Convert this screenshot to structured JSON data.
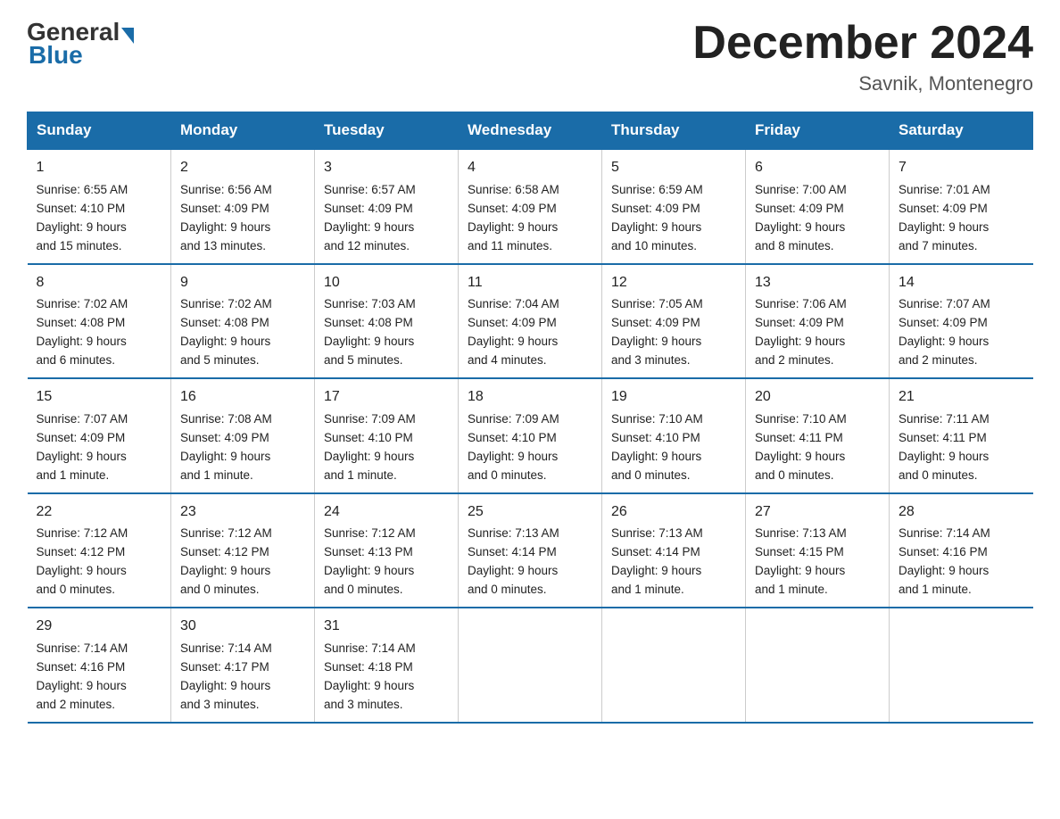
{
  "header": {
    "logo_general": "General",
    "logo_blue": "Blue",
    "main_title": "December 2024",
    "subtitle": "Savnik, Montenegro"
  },
  "weekdays": [
    "Sunday",
    "Monday",
    "Tuesday",
    "Wednesday",
    "Thursday",
    "Friday",
    "Saturday"
  ],
  "weeks": [
    [
      {
        "day": "1",
        "info": "Sunrise: 6:55 AM\nSunset: 4:10 PM\nDaylight: 9 hours\nand 15 minutes."
      },
      {
        "day": "2",
        "info": "Sunrise: 6:56 AM\nSunset: 4:09 PM\nDaylight: 9 hours\nand 13 minutes."
      },
      {
        "day": "3",
        "info": "Sunrise: 6:57 AM\nSunset: 4:09 PM\nDaylight: 9 hours\nand 12 minutes."
      },
      {
        "day": "4",
        "info": "Sunrise: 6:58 AM\nSunset: 4:09 PM\nDaylight: 9 hours\nand 11 minutes."
      },
      {
        "day": "5",
        "info": "Sunrise: 6:59 AM\nSunset: 4:09 PM\nDaylight: 9 hours\nand 10 minutes."
      },
      {
        "day": "6",
        "info": "Sunrise: 7:00 AM\nSunset: 4:09 PM\nDaylight: 9 hours\nand 8 minutes."
      },
      {
        "day": "7",
        "info": "Sunrise: 7:01 AM\nSunset: 4:09 PM\nDaylight: 9 hours\nand 7 minutes."
      }
    ],
    [
      {
        "day": "8",
        "info": "Sunrise: 7:02 AM\nSunset: 4:08 PM\nDaylight: 9 hours\nand 6 minutes."
      },
      {
        "day": "9",
        "info": "Sunrise: 7:02 AM\nSunset: 4:08 PM\nDaylight: 9 hours\nand 5 minutes."
      },
      {
        "day": "10",
        "info": "Sunrise: 7:03 AM\nSunset: 4:08 PM\nDaylight: 9 hours\nand 5 minutes."
      },
      {
        "day": "11",
        "info": "Sunrise: 7:04 AM\nSunset: 4:09 PM\nDaylight: 9 hours\nand 4 minutes."
      },
      {
        "day": "12",
        "info": "Sunrise: 7:05 AM\nSunset: 4:09 PM\nDaylight: 9 hours\nand 3 minutes."
      },
      {
        "day": "13",
        "info": "Sunrise: 7:06 AM\nSunset: 4:09 PM\nDaylight: 9 hours\nand 2 minutes."
      },
      {
        "day": "14",
        "info": "Sunrise: 7:07 AM\nSunset: 4:09 PM\nDaylight: 9 hours\nand 2 minutes."
      }
    ],
    [
      {
        "day": "15",
        "info": "Sunrise: 7:07 AM\nSunset: 4:09 PM\nDaylight: 9 hours\nand 1 minute."
      },
      {
        "day": "16",
        "info": "Sunrise: 7:08 AM\nSunset: 4:09 PM\nDaylight: 9 hours\nand 1 minute."
      },
      {
        "day": "17",
        "info": "Sunrise: 7:09 AM\nSunset: 4:10 PM\nDaylight: 9 hours\nand 1 minute."
      },
      {
        "day": "18",
        "info": "Sunrise: 7:09 AM\nSunset: 4:10 PM\nDaylight: 9 hours\nand 0 minutes."
      },
      {
        "day": "19",
        "info": "Sunrise: 7:10 AM\nSunset: 4:10 PM\nDaylight: 9 hours\nand 0 minutes."
      },
      {
        "day": "20",
        "info": "Sunrise: 7:10 AM\nSunset: 4:11 PM\nDaylight: 9 hours\nand 0 minutes."
      },
      {
        "day": "21",
        "info": "Sunrise: 7:11 AM\nSunset: 4:11 PM\nDaylight: 9 hours\nand 0 minutes."
      }
    ],
    [
      {
        "day": "22",
        "info": "Sunrise: 7:12 AM\nSunset: 4:12 PM\nDaylight: 9 hours\nand 0 minutes."
      },
      {
        "day": "23",
        "info": "Sunrise: 7:12 AM\nSunset: 4:12 PM\nDaylight: 9 hours\nand 0 minutes."
      },
      {
        "day": "24",
        "info": "Sunrise: 7:12 AM\nSunset: 4:13 PM\nDaylight: 9 hours\nand 0 minutes."
      },
      {
        "day": "25",
        "info": "Sunrise: 7:13 AM\nSunset: 4:14 PM\nDaylight: 9 hours\nand 0 minutes."
      },
      {
        "day": "26",
        "info": "Sunrise: 7:13 AM\nSunset: 4:14 PM\nDaylight: 9 hours\nand 1 minute."
      },
      {
        "day": "27",
        "info": "Sunrise: 7:13 AM\nSunset: 4:15 PM\nDaylight: 9 hours\nand 1 minute."
      },
      {
        "day": "28",
        "info": "Sunrise: 7:14 AM\nSunset: 4:16 PM\nDaylight: 9 hours\nand 1 minute."
      }
    ],
    [
      {
        "day": "29",
        "info": "Sunrise: 7:14 AM\nSunset: 4:16 PM\nDaylight: 9 hours\nand 2 minutes."
      },
      {
        "day": "30",
        "info": "Sunrise: 7:14 AM\nSunset: 4:17 PM\nDaylight: 9 hours\nand 3 minutes."
      },
      {
        "day": "31",
        "info": "Sunrise: 7:14 AM\nSunset: 4:18 PM\nDaylight: 9 hours\nand 3 minutes."
      },
      {
        "day": "",
        "info": ""
      },
      {
        "day": "",
        "info": ""
      },
      {
        "day": "",
        "info": ""
      },
      {
        "day": "",
        "info": ""
      }
    ]
  ]
}
